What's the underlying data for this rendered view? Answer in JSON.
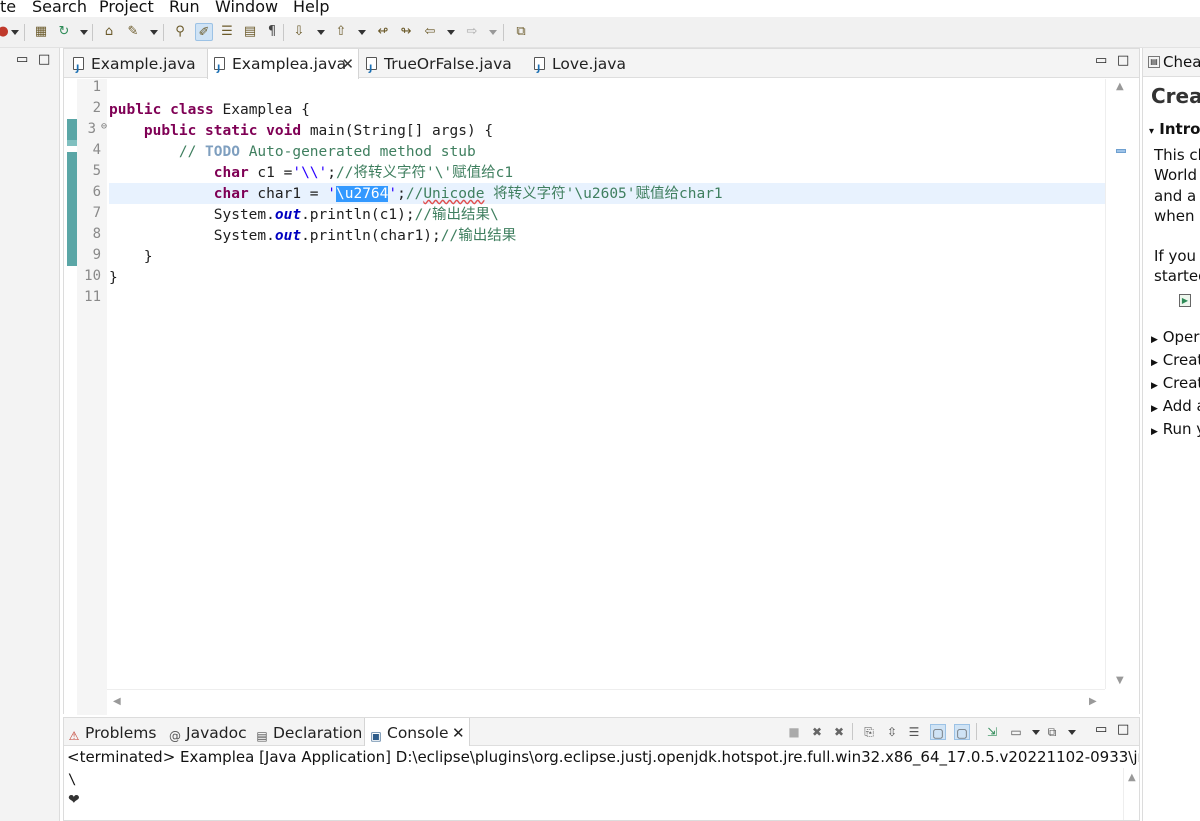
{
  "menu": [
    "te",
    "Search",
    "Project",
    "Run",
    "Window",
    "Help"
  ],
  "editor": {
    "tabs": [
      {
        "label": "Example.java",
        "active": false
      },
      {
        "label": "Examplea.java",
        "active": true
      },
      {
        "label": "TrueOrFalse.java",
        "active": false
      },
      {
        "label": "Love.java",
        "active": false
      }
    ],
    "close_glyph": "✕",
    "minimize_glyph": "▭",
    "maximize_glyph": "□",
    "line_numbers": [
      "1",
      "2",
      "3",
      "4",
      "5",
      "6",
      "7",
      "8",
      "9",
      "10",
      "11"
    ],
    "fold_marker": "⊖",
    "code": {
      "l2": {
        "kw1": "public",
        "kw2": "class",
        "rest": " Examplea {"
      },
      "l3": {
        "indent": "    ",
        "kw1": "public",
        "kw2": "static",
        "kw3": "void",
        "rest": " main(String[] args) {"
      },
      "l4": {
        "indent": "        ",
        "pre": "// ",
        "todo": "TODO",
        "post": " Auto-generated method stub"
      },
      "l5": {
        "indent": "            ",
        "kw": "char",
        "rest": " c1 =",
        "str": "'\\\\'",
        "semi": ";",
        "comment": "//将转义字符'\\'赋值给c1"
      },
      "l6": {
        "indent": "            ",
        "kw": "char",
        "rest": " char1 = ",
        "q1": "'",
        "sel": "\\u2764",
        "q2": "'",
        "semi": ";",
        "c_pre": "//",
        "c_squig": "Unicode",
        "c_post": " 将转义字符'\\u2605'赋值给char1"
      },
      "l7": {
        "indent": "            ",
        "pre": "System.",
        "fld": "out",
        "post": ".println(c1);",
        "comment": "//输出结果\\"
      },
      "l8": {
        "indent": "            ",
        "pre": "System.",
        "fld": "out",
        "post": ".println(char1);",
        "comment": "//输出结果"
      },
      "l9": {
        "text": "    }"
      },
      "l10": {
        "text": "}"
      }
    }
  },
  "console": {
    "tabs": [
      {
        "label": "Problems",
        "icon": "problems-icon"
      },
      {
        "label": "Javadoc",
        "icon": "javadoc-icon"
      },
      {
        "label": "Declaration",
        "icon": "declaration-icon"
      },
      {
        "label": "Console",
        "icon": "console-icon"
      }
    ],
    "close_glyph": "✕",
    "at_glyph": "@",
    "terminated": "<terminated> Examplea [Java Application] D:\\eclipse\\plugins\\org.eclipse.justj.openjdk.hotspot.jre.full.win32.x86_64_17.0.5.v20221102-0933\\jre\\bin\\",
    "output": [
      "\\",
      "❤"
    ]
  },
  "cheatsheet": {
    "tab": "Chea",
    "title": "Creat",
    "section": "Intro",
    "lines": [
      "This ch",
      "World",
      "and a .",
      "when r"
    ],
    "lines2": [
      "If you r",
      "started"
    ],
    "items": [
      "Oper",
      "Creat",
      "Creat",
      "Add a",
      "Run y"
    ]
  }
}
